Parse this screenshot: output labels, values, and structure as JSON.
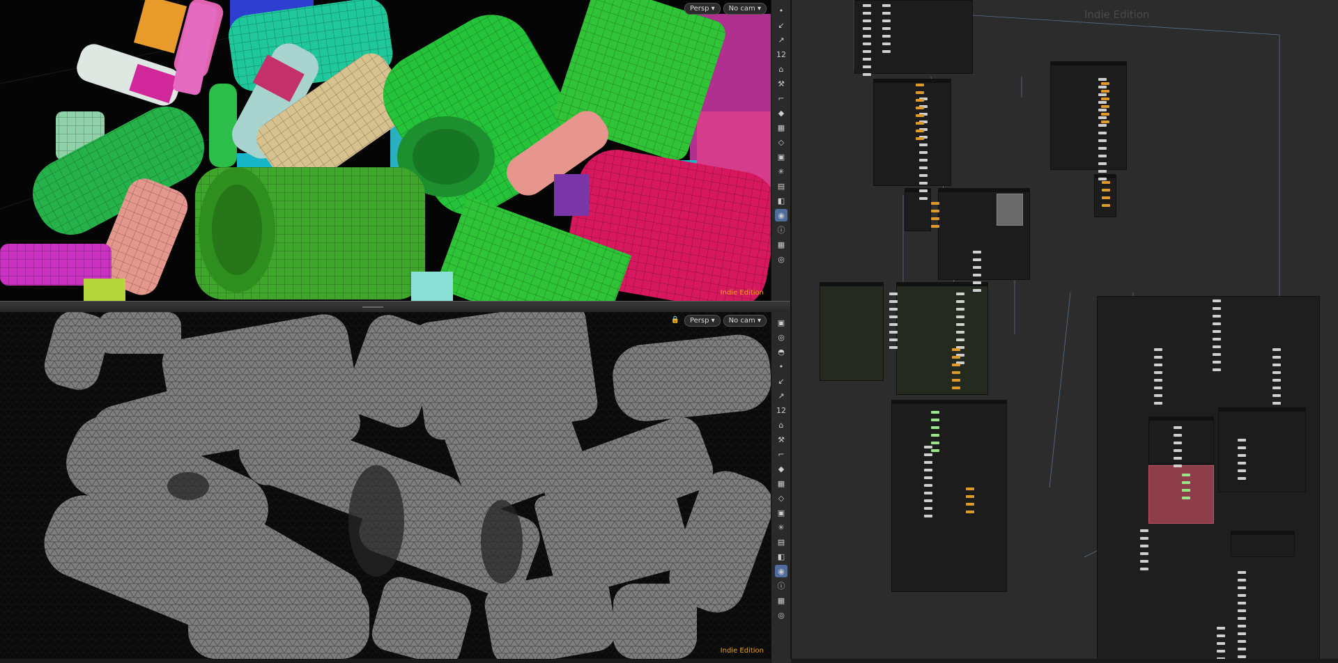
{
  "viewport_top": {
    "camera_menu": "Persp ▾",
    "view_menu": "No cam ▾",
    "edition_label": "Indie Edition"
  },
  "viewport_bottom": {
    "lock_icon": "lock-icon",
    "camera_menu": "Persp ▾",
    "view_menu": "No cam ▾",
    "edition_label": "Indie Edition"
  },
  "toolbar_top": {
    "tools": [
      "•",
      "↙",
      "↗",
      "12",
      "⌂",
      "⚒",
      "⌐",
      "◆",
      "▦",
      "◇",
      "▣",
      "✳",
      "▤",
      "◧",
      "◉",
      "ⓘ",
      "▦",
      "◎"
    ]
  },
  "toolbar_bottom": {
    "tools": [
      "▣",
      "◎",
      "◓",
      "•",
      "↙",
      "↗",
      "12",
      "⌂",
      "⚒",
      "⌐",
      "◆",
      "▦",
      "◇",
      "▣",
      "✳",
      "▤",
      "◧",
      "◉",
      "ⓘ",
      "▦",
      "◎"
    ]
  },
  "network": {
    "edition_label": "Indie Edition"
  },
  "colors": {
    "accent_indie": "#e8a21a",
    "node_orange": "#e09a2a",
    "node_yellow": "#e6d23e",
    "node_green": "#9be48a",
    "highlight_blue": "#506d9e"
  }
}
